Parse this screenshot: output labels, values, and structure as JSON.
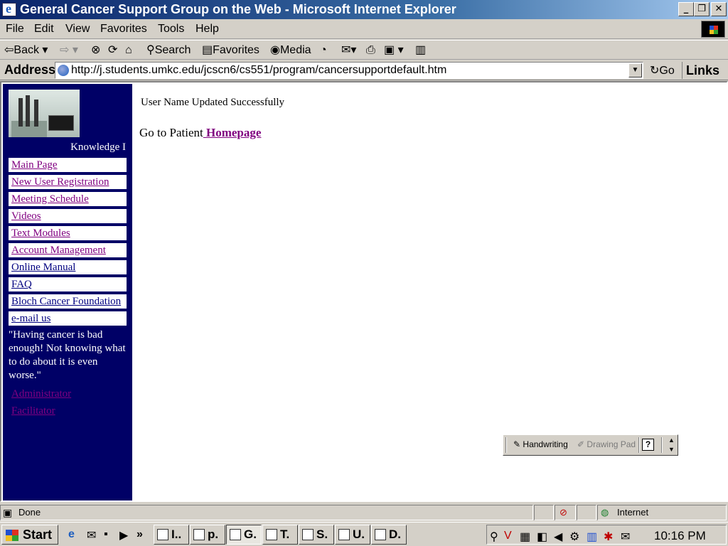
{
  "window": {
    "title": "General Cancer Support Group on the Web - Microsoft Internet Explorer",
    "minimize": "_",
    "restore": "❐",
    "close": "✕"
  },
  "menu": [
    "File",
    "Edit",
    "View",
    "Favorites",
    "Tools",
    "Help"
  ],
  "toolbar": {
    "back": "Back",
    "search": "Search",
    "favorites": "Favorites",
    "media": "Media"
  },
  "address": {
    "label": "Address",
    "url": "http://j.students.umkc.edu/jcscn6/cs551/program/cancersupportdefault.htm",
    "go": "Go",
    "links": "Links"
  },
  "sidebar": {
    "tagline": "Knowledge I",
    "links": [
      "Main Page",
      "New User Registration",
      "Meeting Schedule",
      "Videos",
      "Text Modules",
      "Account Management",
      "Online Manual",
      "FAQ",
      "Bloch Cancer Foundation",
      "e-mail us"
    ],
    "quote": "\"Having cancer is bad enough! Not knowing what to do about it is even worse.\"",
    "admin_links": [
      "Administrator",
      "Facilitator"
    ]
  },
  "main": {
    "message": "User Name Updated Successfully",
    "goto_prefix": "Go to Patient",
    "goto_link": " Homepage"
  },
  "handwriting_bar": {
    "handwriting": "Handwriting",
    "drawing_pad": "Drawing Pad",
    "help": "?"
  },
  "status": {
    "text": "Done",
    "zone": "Internet"
  },
  "taskbar": {
    "start": "Start",
    "tasks": [
      "I..",
      "p.",
      "G.",
      "T.",
      "S.",
      "U.",
      "D."
    ],
    "clock": "10:16 PM"
  }
}
